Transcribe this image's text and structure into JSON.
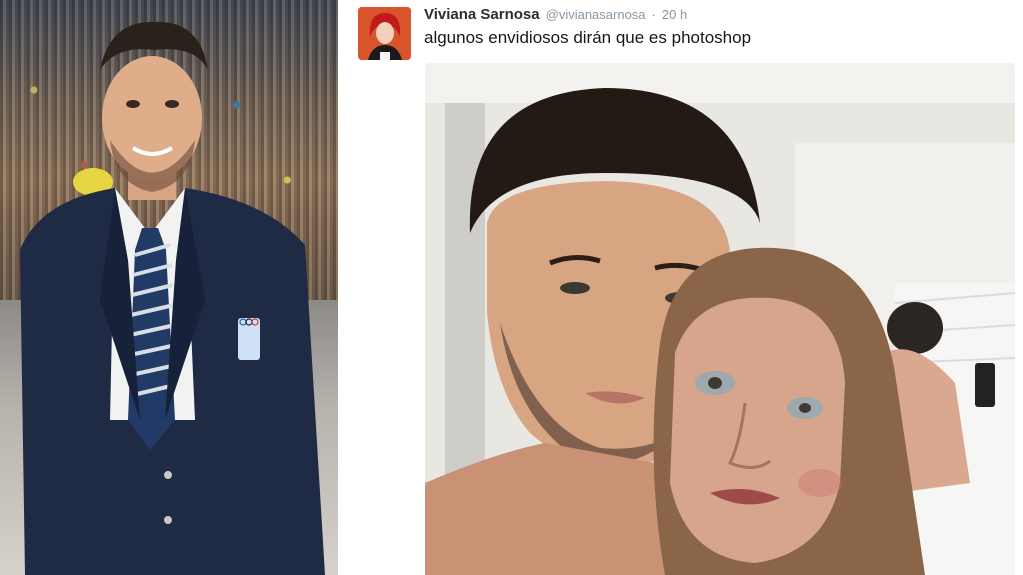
{
  "tweet": {
    "display_name": "Viviana Sarnosa",
    "handle": "@vivianasarnosa",
    "separator": "·",
    "time": "20 h",
    "text": "algunos envidiosos dirán que es photoshop"
  },
  "icons": {
    "avatar": "avatar-cartoon-redhead",
    "olympic_badge": "olympic-rings-icon"
  },
  "colors": {
    "name": "#292f33",
    "meta": "#8899a6",
    "text": "#14171a",
    "blazer": "#1f2a44"
  }
}
